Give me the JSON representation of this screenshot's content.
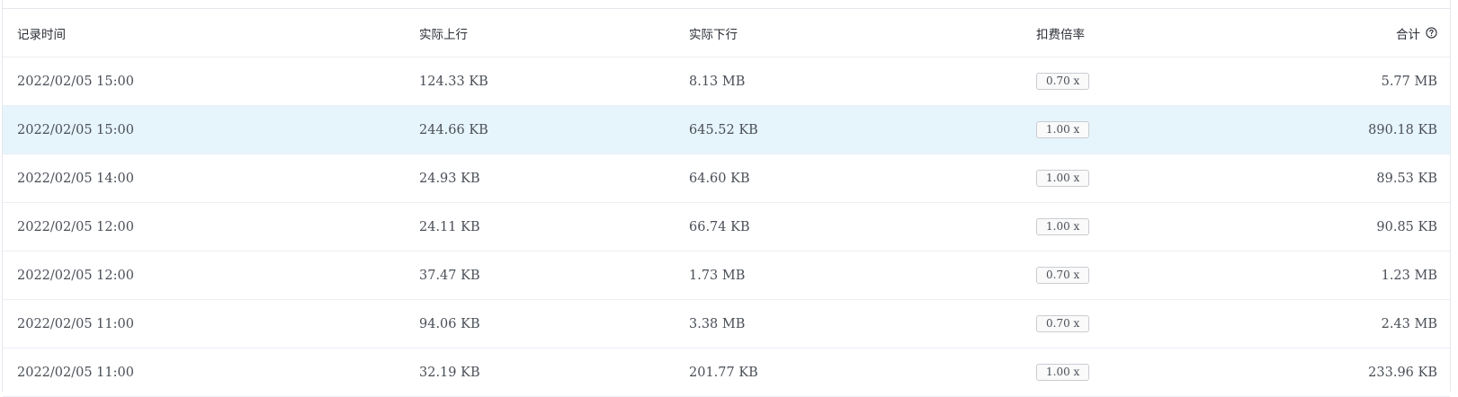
{
  "table": {
    "columns": {
      "time": "记录时间",
      "upload": "实际上行",
      "download": "实际下行",
      "rate": "扣费倍率",
      "total": "合计"
    },
    "rows": [
      {
        "time": "2022/02/05 15:00",
        "upload": "124.33 KB",
        "download": "8.13 MB",
        "rate": "0.70 x",
        "total": "5.77 MB",
        "highlighted": false
      },
      {
        "time": "2022/02/05 15:00",
        "upload": "244.66 KB",
        "download": "645.52 KB",
        "rate": "1.00 x",
        "total": "890.18 KB",
        "highlighted": true
      },
      {
        "time": "2022/02/05 14:00",
        "upload": "24.93 KB",
        "download": "64.60 KB",
        "rate": "1.00 x",
        "total": "89.53 KB",
        "highlighted": false
      },
      {
        "time": "2022/02/05 12:00",
        "upload": "24.11 KB",
        "download": "66.74 KB",
        "rate": "1.00 x",
        "total": "90.85 KB",
        "highlighted": false
      },
      {
        "time": "2022/02/05 12:00",
        "upload": "37.47 KB",
        "download": "1.73 MB",
        "rate": "0.70 x",
        "total": "1.23 MB",
        "highlighted": false
      },
      {
        "time": "2022/02/05 11:00",
        "upload": "94.06 KB",
        "download": "3.38 MB",
        "rate": "0.70 x",
        "total": "2.43 MB",
        "highlighted": false
      },
      {
        "time": "2022/02/05 11:00",
        "upload": "32.19 KB",
        "download": "201.77 KB",
        "rate": "1.00 x",
        "total": "233.96 KB",
        "highlighted": false
      }
    ]
  },
  "icons": {
    "total_help": "question-circle-icon"
  },
  "colors": {
    "highlight_row": "#e6f4fc",
    "border": "#ebeef3"
  }
}
